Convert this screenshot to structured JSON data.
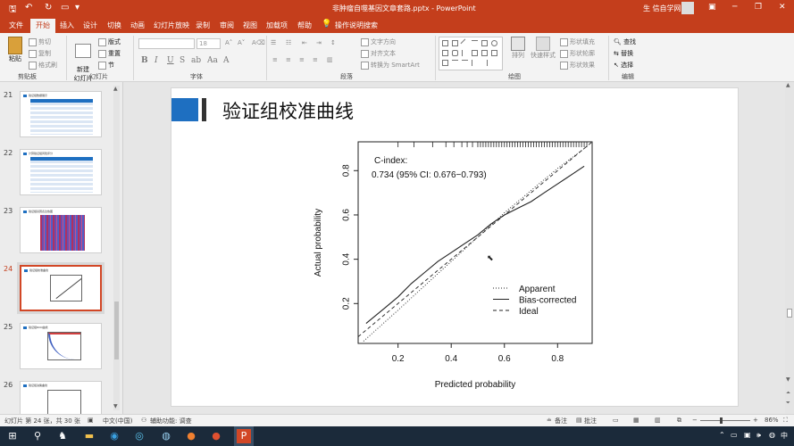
{
  "window": {
    "title": "非肿瘤自噬基因文章套路.pptx - PowerPoint",
    "user_name": "生 信自学网"
  },
  "tabs": [
    {
      "label": "文件"
    },
    {
      "label": "开始"
    },
    {
      "label": "插入"
    },
    {
      "label": "设计"
    },
    {
      "label": "切换"
    },
    {
      "label": "动画"
    },
    {
      "label": "幻灯片放映"
    },
    {
      "label": "录制"
    },
    {
      "label": "审阅"
    },
    {
      "label": "视图"
    },
    {
      "label": "加载项"
    },
    {
      "label": "帮助"
    }
  ],
  "tell_me": "操作说明搜索",
  "ribbon": {
    "paste": "粘贴",
    "cut": "剪切",
    "copy": "复制",
    "format_painter": "格式刷",
    "new_slide": "新建\n幻灯片",
    "layout": "版式",
    "reset": "重置",
    "section": "节",
    "font_size": "18",
    "text_direction": "文字方向",
    "align_text": "对齐文本",
    "smartart": "转换为 SmartArt",
    "arrange": "排列",
    "quick_styles": "快速样式",
    "shape_fill": "形状填充",
    "shape_outline": "形状轮廓",
    "shape_effects": "形状效果",
    "find": "查找",
    "replace": "替换",
    "select": "选择",
    "groups": {
      "clipboard": "剪贴板",
      "slides": "幻灯片",
      "font": "字体",
      "paragraph": "段落",
      "drawing": "绘图",
      "editing": "编辑"
    }
  },
  "thumbnails": [
    {
      "number": "21",
      "title": "验证组数据展示"
    },
    {
      "number": "22",
      "title": "计算验证组风险评分"
    },
    {
      "number": "23",
      "title": "验证组基因表达热图"
    },
    {
      "number": "24",
      "title": "验证组校准曲线",
      "selected": true
    },
    {
      "number": "25",
      "title": "验证组ROC曲线"
    },
    {
      "number": "26",
      "title": "验证组决策曲线"
    }
  ],
  "slide": {
    "title": "验证组校准曲线"
  },
  "chart_data": {
    "type": "line",
    "xlabel": "Predicted probability",
    "ylabel": "Actual probability",
    "xticks": [
      "0.2",
      "0.4",
      "0.6",
      "0.8"
    ],
    "yticks": [
      "0.2",
      "0.4",
      "0.6",
      "0.8"
    ],
    "xlim": [
      0.05,
      0.93
    ],
    "ylim": [
      0.02,
      0.93
    ],
    "annotation_line1": "C-index:",
    "annotation_line2": "0.734 (95% CI: 0.676−0.793)",
    "legend_position": "bottom-right",
    "series": [
      {
        "name": "Apparent",
        "style": "dotted",
        "x": [
          0.07,
          0.2,
          0.3,
          0.4,
          0.5,
          0.6,
          0.7,
          0.8,
          0.9
        ],
        "y": [
          0.03,
          0.17,
          0.28,
          0.39,
          0.5,
          0.61,
          0.71,
          0.81,
          0.9
        ]
      },
      {
        "name": "Bias-corrected",
        "style": "solid",
        "x": [
          0.08,
          0.15,
          0.2,
          0.25,
          0.3,
          0.35,
          0.4,
          0.45,
          0.5,
          0.55,
          0.6,
          0.65,
          0.7,
          0.75,
          0.8,
          0.85,
          0.9
        ],
        "y": [
          0.11,
          0.18,
          0.23,
          0.29,
          0.34,
          0.39,
          0.43,
          0.47,
          0.51,
          0.56,
          0.6,
          0.63,
          0.66,
          0.7,
          0.74,
          0.78,
          0.82
        ]
      },
      {
        "name": "Ideal",
        "style": "dashed",
        "x": [
          0.05,
          0.93
        ],
        "y": [
          0.05,
          0.93
        ]
      }
    ],
    "rug": [
      0.2,
      0.26,
      0.33,
      0.38,
      0.41,
      0.44,
      0.46,
      0.48,
      0.5,
      0.51,
      0.52,
      0.53,
      0.54,
      0.55,
      0.56,
      0.57,
      0.58,
      0.59,
      0.6,
      0.61,
      0.62,
      0.63,
      0.64,
      0.65,
      0.66,
      0.67,
      0.68,
      0.69,
      0.7,
      0.71,
      0.72,
      0.73,
      0.74,
      0.75,
      0.76,
      0.77,
      0.78,
      0.79,
      0.8,
      0.81,
      0.82,
      0.83,
      0.84,
      0.85,
      0.86,
      0.87,
      0.88,
      0.89,
      0.9,
      0.91
    ]
  },
  "statusbar": {
    "slide_info": "幻灯片 第 24 张，共 30 张",
    "language": "中文(中国)",
    "accessibility": "辅助功能: 调查",
    "notes": "备注",
    "comments": "批注",
    "zoom": "86%"
  },
  "taskbar": {
    "lang": "中"
  }
}
